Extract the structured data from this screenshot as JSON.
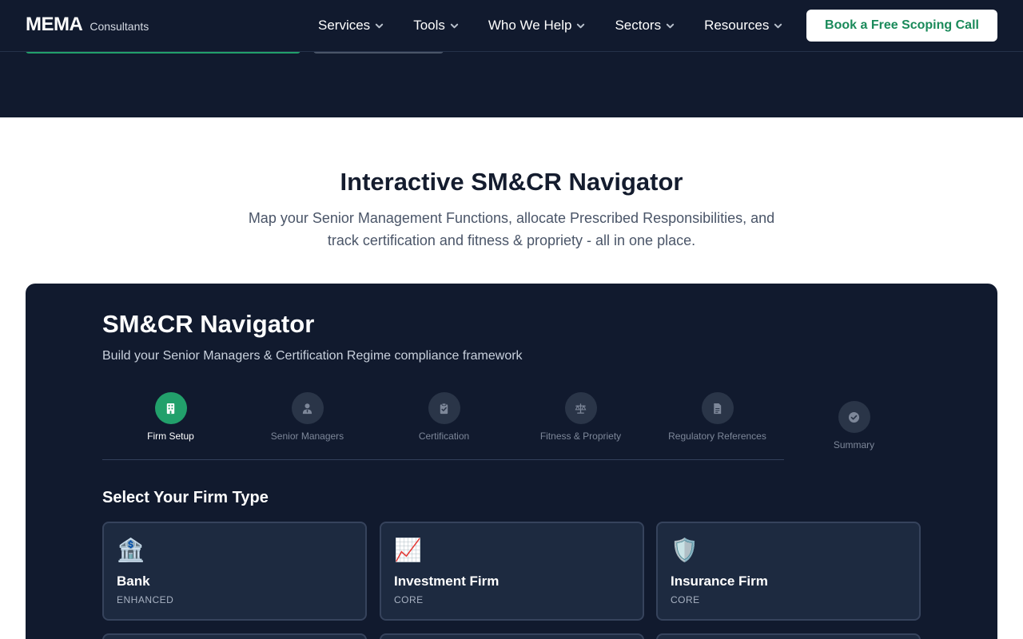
{
  "header": {
    "logo_main": "MEMA",
    "logo_sub": "Consultants",
    "nav": [
      {
        "label": "Services"
      },
      {
        "label": "Tools"
      },
      {
        "label": "Who We Help"
      },
      {
        "label": "Sectors"
      },
      {
        "label": "Resources"
      }
    ],
    "cta_label": "Book a Free Scoping Call"
  },
  "intro": {
    "title": "Interactive SM&CR Navigator",
    "description": "Map your Senior Management Functions, allocate Prescribed Responsibilities, and track certification and fitness & propriety - all in one place."
  },
  "navigator": {
    "title": "SM&CR Navigator",
    "subtitle": "Build your Senior Managers & Certification Regime compliance framework",
    "steps": [
      {
        "label": "Firm Setup",
        "icon": "building-icon",
        "active": true
      },
      {
        "label": "Senior Managers",
        "icon": "user-tie-icon",
        "active": false
      },
      {
        "label": "Certification",
        "icon": "clipboard-check-icon",
        "active": false
      },
      {
        "label": "Fitness & Propriety",
        "icon": "balance-scale-icon",
        "active": false
      },
      {
        "label": "Regulatory References",
        "icon": "file-icon",
        "active": false
      },
      {
        "label": "Summary",
        "icon": "check-circle-icon",
        "active": false
      }
    ],
    "firm_type_heading": "Select Your Firm Type",
    "firm_types": [
      {
        "icon": "🏦",
        "name": "Bank",
        "tier": "ENHANCED"
      },
      {
        "icon": "📈",
        "name": "Investment Firm",
        "tier": "CORE"
      },
      {
        "icon": "🛡️",
        "name": "Insurance Firm",
        "tier": "CORE"
      }
    ]
  },
  "colors": {
    "header_bg": "#111a2e",
    "panel_bg": "#111a2e",
    "accent_green": "#22a06b",
    "cta_text": "#1a8a5a",
    "card_bg": "#1d2a40"
  }
}
